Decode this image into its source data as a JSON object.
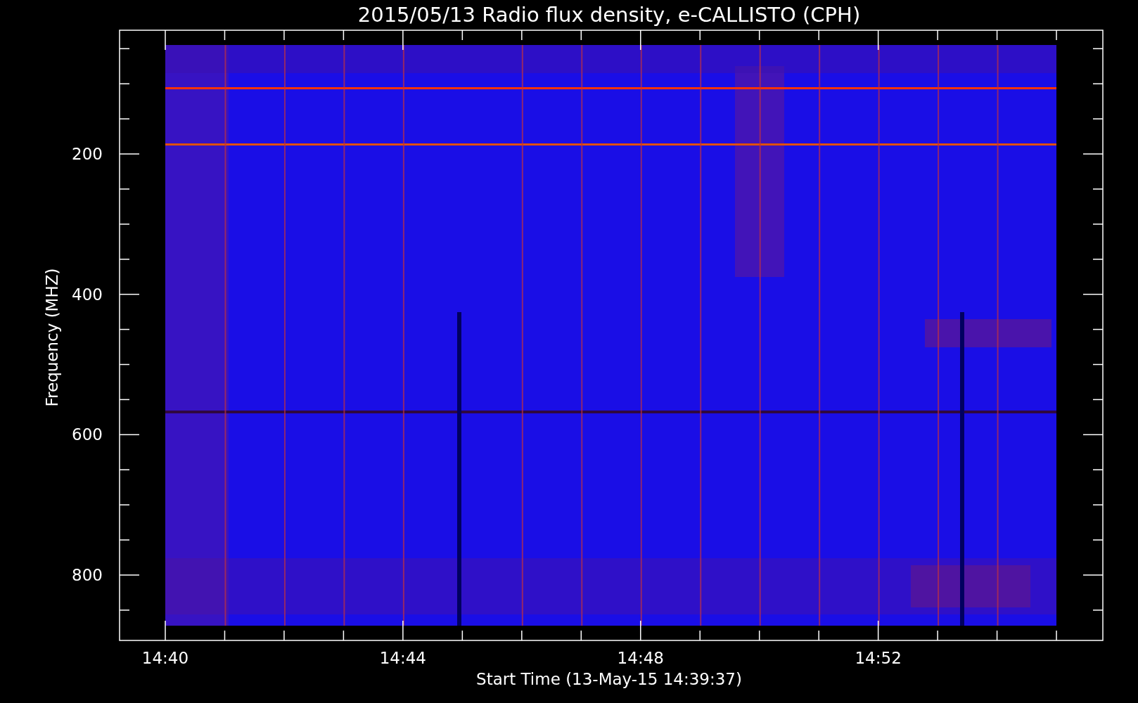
{
  "title": "2015/05/13  Radio flux density, e-CALLISTO (CPH)",
  "y_axis": {
    "label": "Frequency (MHZ)",
    "tick_labels": [
      "200",
      "400",
      "600",
      "800"
    ]
  },
  "x_axis": {
    "label": "Start Time (13-May-15 14:39:37)",
    "tick_labels": [
      "14:40",
      "14:44",
      "14:48",
      "14:52"
    ]
  }
}
